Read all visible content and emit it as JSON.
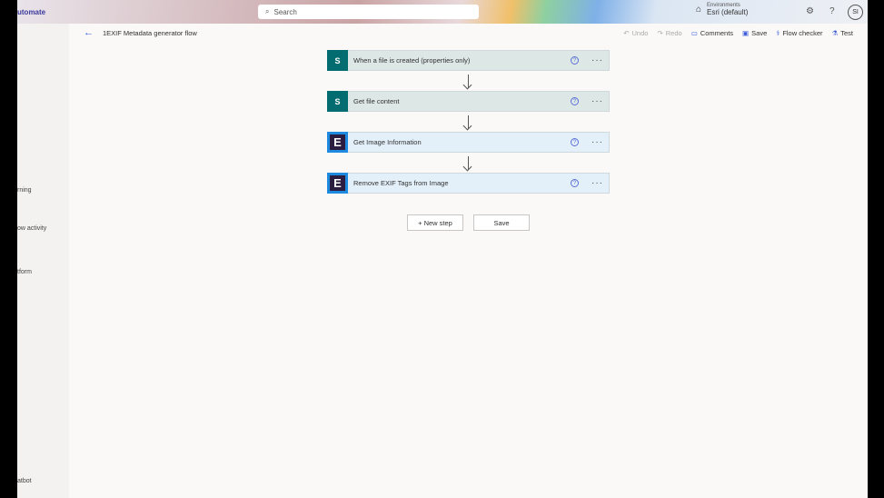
{
  "header": {
    "brand": "utomate",
    "search_placeholder": "Search",
    "env_label": "Environments",
    "env_value": "Esri (default)",
    "avatar": "SI"
  },
  "sidebar": {
    "items": [
      "rning",
      "ow activity",
      "tform",
      "atbot"
    ]
  },
  "cmdbar": {
    "title": "1EXIF Metadata generator flow",
    "undo": "Undo",
    "redo": "Redo",
    "comments": "Comments",
    "save": "Save",
    "flow_checker": "Flow checker",
    "test": "Test"
  },
  "steps": [
    {
      "title": "When a file is created (properties only)",
      "connector": "sharepoint"
    },
    {
      "title": "Get file content",
      "connector": "sharepoint"
    },
    {
      "title": "Get Image Information",
      "connector": "image"
    },
    {
      "title": "Remove EXIF Tags from Image",
      "connector": "image"
    }
  ],
  "actions": {
    "new_step": "+ New step",
    "save": "Save"
  }
}
